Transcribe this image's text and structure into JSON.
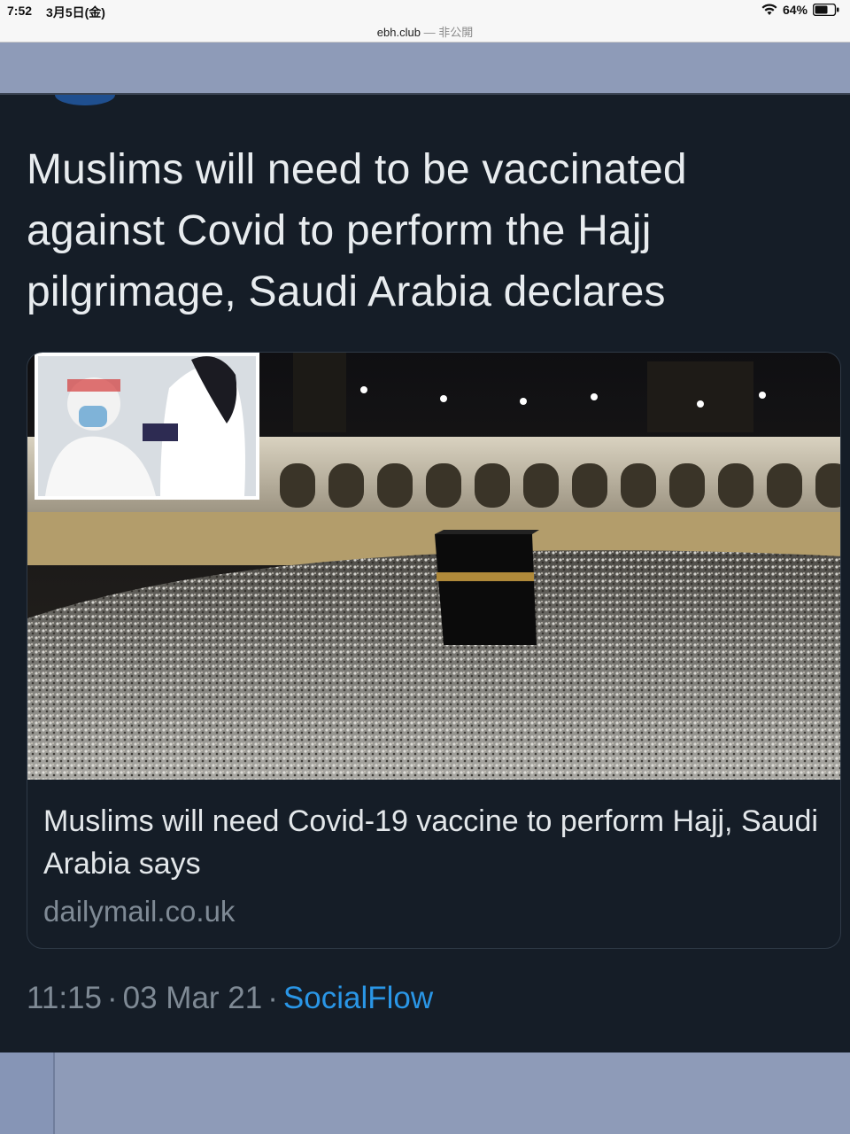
{
  "status_bar": {
    "time": "7:52",
    "date": "3月5日(金)",
    "battery_percent": "64%",
    "wifi_icon": "wifi-icon",
    "battery_icon": "battery-icon"
  },
  "url_bar": {
    "domain": "ebh.club",
    "visibility": "— 非公開"
  },
  "tweet": {
    "text": "Muslims will need to be vaccinated against Covid to perform the Hajj pilgrimage, Saudi Arabia declares",
    "card": {
      "headline": "Muslims will need Covid-19 vaccine to perform Hajj, Saudi Arabia says",
      "domain": "dailymail.co.uk"
    },
    "time": "11:15",
    "date": "03 Mar 21",
    "separator": "·",
    "source": "SocialFlow"
  },
  "colors": {
    "tweet_background": "#151d27",
    "source_link": "#2a96e6",
    "meta_text": "#7f8a95",
    "page_background": "#8e9bb8"
  }
}
